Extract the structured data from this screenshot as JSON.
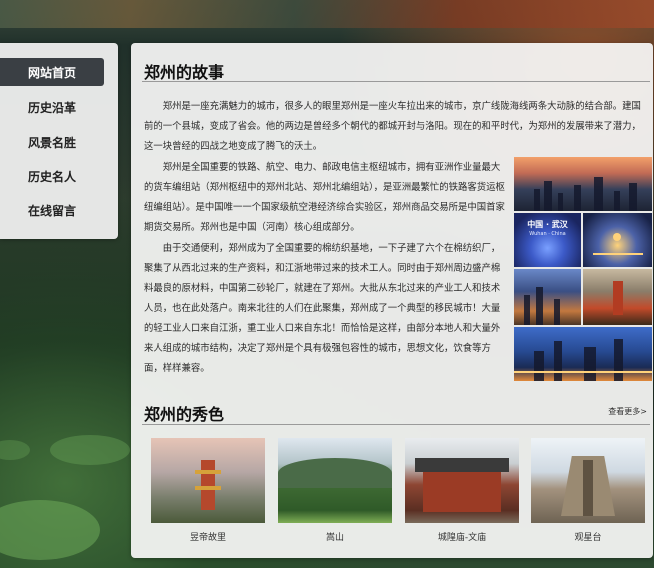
{
  "nav": {
    "items": [
      {
        "label": "网站首页",
        "active": true
      },
      {
        "label": "历史沿革"
      },
      {
        "label": "风景名胜"
      },
      {
        "label": "历史名人"
      },
      {
        "label": "在线留言"
      }
    ]
  },
  "story": {
    "title": "郑州的故事",
    "paragraphs": [
      "郑州是一座充满魅力的城市，很多人的眼里郑州是一座火车拉出来的城市，京广线陇海线两条大动脉的结合部。建国前的一个县城，变成了省会。他的两边是曾经多个朝代的都城开封与洛阳。现在的和平时代，为郑州的发展带来了潜力，这一块曾经的四战之地变成了腾飞的沃土。",
      "郑州是全国重要的铁路、航空、电力、邮政电信主枢纽城市，拥有亚洲作业量最大的货车编组站（郑州枢纽中的郑州北站、郑州北编组站），是亚洲最繁忙的铁路客货运枢纽编组站）。是中国唯一一个国家级航空港经济综合实验区，郑州商品交易所是中国首家期货交易所。郑州也是中国（河南）核心组成部分。",
      "由于交通便利，郑州成为了全国重要的棉纺织基地，一下子建了六个在棉纺织厂，聚集了从西北过来的生产资料，和江浙地带过来的技术工人。同时由于郑州周边盛产棉料最良的原材料，中国第二砂轮厂，就建在了郑州。大批从东北过来的产业工人和技术人员，也在此处落户。南来北往的人们在此聚集，郑州成了一个典型的移民城市！大量的轻工业人口来自江浙，重工业人口来自东北！而恰恰是这样，由部分本地人和大量外来人组成的城市结构，决定了郑州是个具有极强包容性的城市，思想文化，饮食等方面，样样兼容。"
    ]
  },
  "gallery": {
    "title": "郑州的秀色",
    "more_label": "查看更多>",
    "items": [
      {
        "caption": "昱帝故里"
      },
      {
        "caption": "嵩山"
      },
      {
        "caption": "城隍庙-文庙"
      },
      {
        "caption": "观星台"
      }
    ]
  },
  "collage": {
    "overlay_text": "中国 · 武汉",
    "overlay_sub": "Wuhan · China"
  }
}
